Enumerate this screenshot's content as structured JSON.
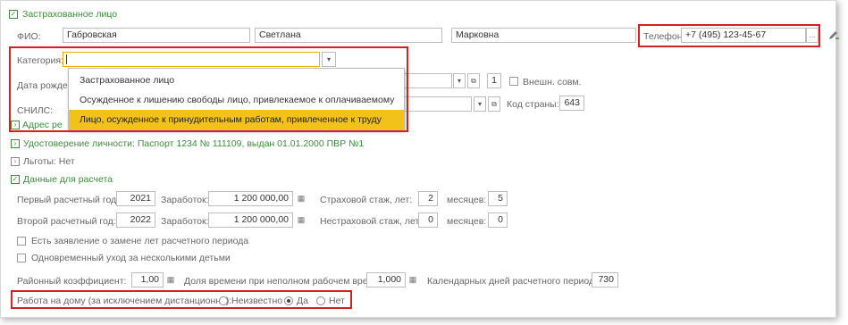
{
  "sections": {
    "insured": "Застрахованное лицо",
    "address": "Адрес ре",
    "identity": "Удостоверение личности: Паспорт 1234 № 111109, выдан 01.01.2000 ПВР №1",
    "benefits": "Льготы: Нет",
    "calc": "Данные для расчета"
  },
  "fio": {
    "label": "ФИО:",
    "last": "Габровская",
    "first": "Светлана",
    "middle": "Марковна"
  },
  "phone": {
    "label": "Телефон:",
    "value": "+7 (495) 123-45-67",
    "btn": "...",
    "icon": "edit-pencil-icon"
  },
  "category": {
    "label": "Категория:",
    "value": "",
    "btn": "▾"
  },
  "dropdown": {
    "items": [
      "Застрахованное лицо",
      "Осужденное к лишению свободы лицо, привлекаемое к оплачиваемому труду",
      "Лицо, осужденное к принудительным работам, привлеченное к труду"
    ],
    "selected_index": 2
  },
  "birth": {
    "label": "Дата рожде",
    "btn": "▾",
    "copy_icon": "⧉",
    "count": "1",
    "ext_label": "Внешн. совм."
  },
  "snils": {
    "label": "СНИЛС:",
    "btn": "▾",
    "copy_icon": "⧉",
    "country_label": "Код страны:",
    "country": "643"
  },
  "calc": {
    "year1_label": "Первый расчетный год:",
    "year1": "2021",
    "earn1_label": "Заработок:",
    "earn1": "1 200 000,00",
    "ins_label": "Страховой стаж, лет:",
    "ins_years": "2",
    "months_label": "месяцев:",
    "ins_months": "5",
    "year2_label": "Второй расчетный год:",
    "year2": "2022",
    "earn2_label": "Заработок:",
    "earn2": "1 200 000,00",
    "nonins_label": "Нестраховой стаж, лет:",
    "nonins_years": "0",
    "months2_label": "месяцев:",
    "nonins_months": "0",
    "chk1": "Есть заявление о замене лет расчетного периода",
    "chk2": "Одновременный уход за несколькими детьми",
    "coef_label": "Районный коэффициент:",
    "coef": "1,00",
    "part_label": "Доля времени при неполном рабочем времени:",
    "part": "1,000",
    "days_label": "Календарных дней расчетного периода:",
    "days": "730",
    "home_label": "Работа на дому (за исключением дистанционно):",
    "opt_unknown": "Неизвестно",
    "opt_yes": "Да",
    "opt_no": "Нет",
    "selected": "Да"
  },
  "colors": {
    "accent_green": "#3a8f3a",
    "highlight_red": "#d42020",
    "selection_yellow": "#f2c21b"
  }
}
